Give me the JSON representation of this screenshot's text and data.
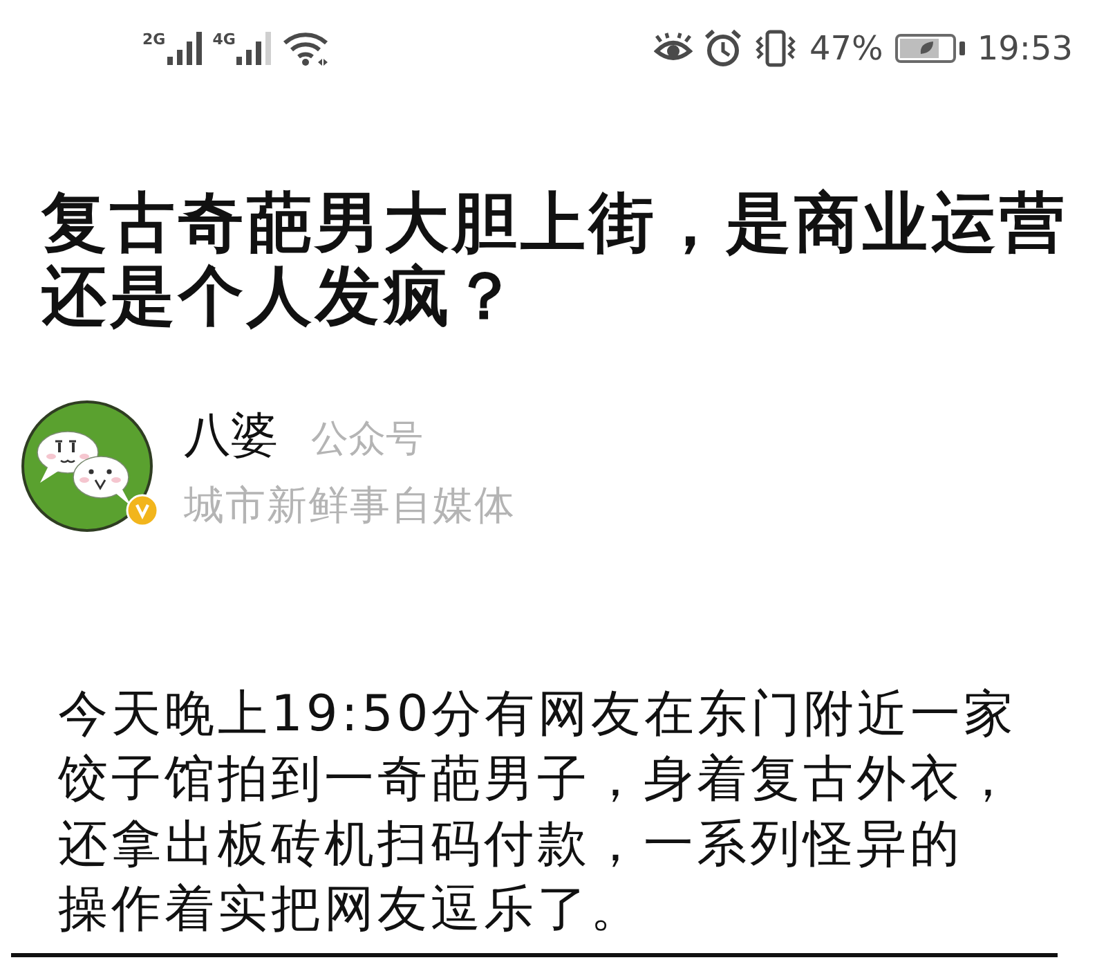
{
  "status_bar": {
    "signals": [
      {
        "label": "2G"
      },
      {
        "label": "4G"
      }
    ],
    "battery_percent": "47%",
    "time": "19:53"
  },
  "article": {
    "title": "复古奇葩男大胆上街，是商业运营还是个人发疯？",
    "author": {
      "name": "八婆",
      "account_type": "公众号",
      "description": "城市新鲜事自媒体",
      "verified": true
    },
    "body": {
      "lines": [
        "今天晚上19:50分有网友在东门附近一家",
        "饺子馆拍到一奇葩男子，身着复古外衣，",
        "还拿出板砖机扫码付款，一系列怪异的",
        "操作着实把网友逗乐了。"
      ]
    }
  }
}
